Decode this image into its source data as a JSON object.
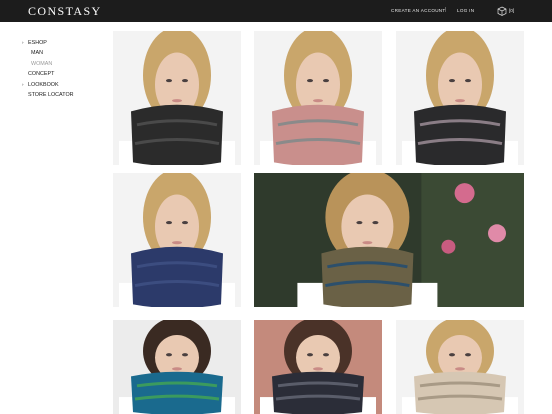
{
  "header": {
    "logo": "CONSTASY",
    "create_account": "CREATE AN ACCOUNT",
    "separator": "|",
    "login": "LOG IN",
    "cart_count": "[0]",
    "cart_icon": "cube-bag-icon"
  },
  "sidebar": {
    "items": [
      {
        "arrow": "›",
        "label": "ESHOP"
      },
      {
        "arrow": "",
        "label": "MAN"
      },
      {
        "arrow": "",
        "label": "WOMAN"
      },
      {
        "arrow": "",
        "label": "CONCEPT"
      },
      {
        "arrow": "›",
        "label": "LOOKBOOK"
      },
      {
        "arrow": "",
        "label": "STORE LOCATOR"
      }
    ]
  },
  "products": [
    {
      "hair": "#c9a66b",
      "scarf": "#2b2b2b",
      "accent": "#4a4a4a",
      "bg": "#f3f3f3"
    },
    {
      "hair": "#c9a66b",
      "scarf": "#c98f8c",
      "accent": "#8a8a8a",
      "bg": "#f3f3f3"
    },
    {
      "hair": "#c9a66b",
      "scarf": "#2a2a2c",
      "accent": "#8a7d86",
      "bg": "#f3f3f3"
    },
    {
      "hair": "#c9a66b",
      "scarf": "#2c3a6a",
      "accent": "#3c4d80",
      "bg": "#f3f3f3"
    },
    {
      "hair": "#b9935a",
      "scarf": "#6a6146",
      "accent": "#2c4f6b",
      "bg": "#2f3a2c"
    },
    {
      "hair": "#3a2a22",
      "scarf": "#1a6a8e",
      "accent": "#3b9a5e",
      "bg": "#ececec"
    },
    {
      "hair": "#4a3228",
      "scarf": "#2b2d38",
      "accent": "#5a5d6a",
      "bg": "#c48a7c"
    },
    {
      "hair": "#c9a66b",
      "scarf": "#d6c7b3",
      "accent": "#a89a86",
      "bg": "#f3f3f3"
    }
  ],
  "colors": {
    "topbar": "#1c1c1c",
    "skin": "#e9c9b2"
  }
}
